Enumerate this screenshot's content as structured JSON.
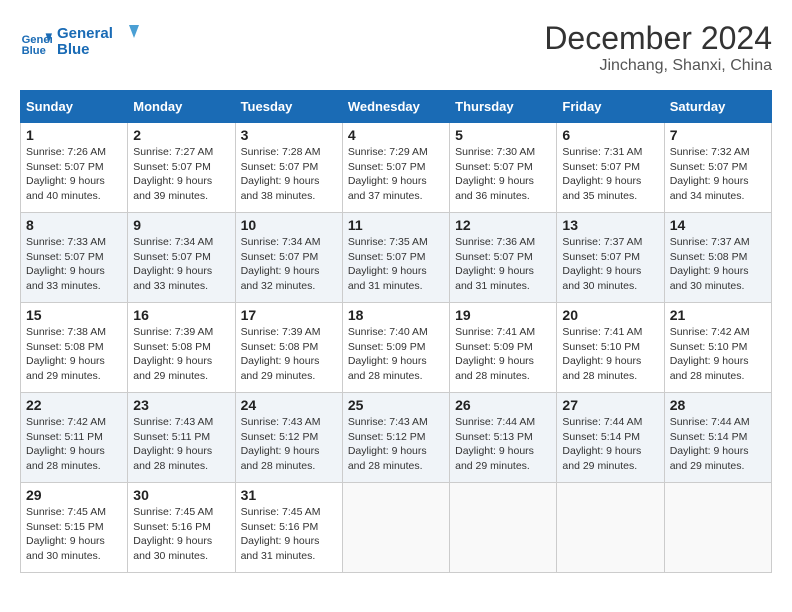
{
  "header": {
    "logo_line1": "General",
    "logo_line2": "Blue",
    "month": "December 2024",
    "location": "Jinchang, Shanxi, China"
  },
  "weekdays": [
    "Sunday",
    "Monday",
    "Tuesday",
    "Wednesday",
    "Thursday",
    "Friday",
    "Saturday"
  ],
  "weeks": [
    [
      {
        "day": "1",
        "sunrise": "Sunrise: 7:26 AM",
        "sunset": "Sunset: 5:07 PM",
        "daylight": "Daylight: 9 hours and 40 minutes."
      },
      {
        "day": "2",
        "sunrise": "Sunrise: 7:27 AM",
        "sunset": "Sunset: 5:07 PM",
        "daylight": "Daylight: 9 hours and 39 minutes."
      },
      {
        "day": "3",
        "sunrise": "Sunrise: 7:28 AM",
        "sunset": "Sunset: 5:07 PM",
        "daylight": "Daylight: 9 hours and 38 minutes."
      },
      {
        "day": "4",
        "sunrise": "Sunrise: 7:29 AM",
        "sunset": "Sunset: 5:07 PM",
        "daylight": "Daylight: 9 hours and 37 minutes."
      },
      {
        "day": "5",
        "sunrise": "Sunrise: 7:30 AM",
        "sunset": "Sunset: 5:07 PM",
        "daylight": "Daylight: 9 hours and 36 minutes."
      },
      {
        "day": "6",
        "sunrise": "Sunrise: 7:31 AM",
        "sunset": "Sunset: 5:07 PM",
        "daylight": "Daylight: 9 hours and 35 minutes."
      },
      {
        "day": "7",
        "sunrise": "Sunrise: 7:32 AM",
        "sunset": "Sunset: 5:07 PM",
        "daylight": "Daylight: 9 hours and 34 minutes."
      }
    ],
    [
      {
        "day": "8",
        "sunrise": "Sunrise: 7:33 AM",
        "sunset": "Sunset: 5:07 PM",
        "daylight": "Daylight: 9 hours and 33 minutes."
      },
      {
        "day": "9",
        "sunrise": "Sunrise: 7:34 AM",
        "sunset": "Sunset: 5:07 PM",
        "daylight": "Daylight: 9 hours and 33 minutes."
      },
      {
        "day": "10",
        "sunrise": "Sunrise: 7:34 AM",
        "sunset": "Sunset: 5:07 PM",
        "daylight": "Daylight: 9 hours and 32 minutes."
      },
      {
        "day": "11",
        "sunrise": "Sunrise: 7:35 AM",
        "sunset": "Sunset: 5:07 PM",
        "daylight": "Daylight: 9 hours and 31 minutes."
      },
      {
        "day": "12",
        "sunrise": "Sunrise: 7:36 AM",
        "sunset": "Sunset: 5:07 PM",
        "daylight": "Daylight: 9 hours and 31 minutes."
      },
      {
        "day": "13",
        "sunrise": "Sunrise: 7:37 AM",
        "sunset": "Sunset: 5:07 PM",
        "daylight": "Daylight: 9 hours and 30 minutes."
      },
      {
        "day": "14",
        "sunrise": "Sunrise: 7:37 AM",
        "sunset": "Sunset: 5:08 PM",
        "daylight": "Daylight: 9 hours and 30 minutes."
      }
    ],
    [
      {
        "day": "15",
        "sunrise": "Sunrise: 7:38 AM",
        "sunset": "Sunset: 5:08 PM",
        "daylight": "Daylight: 9 hours and 29 minutes."
      },
      {
        "day": "16",
        "sunrise": "Sunrise: 7:39 AM",
        "sunset": "Sunset: 5:08 PM",
        "daylight": "Daylight: 9 hours and 29 minutes."
      },
      {
        "day": "17",
        "sunrise": "Sunrise: 7:39 AM",
        "sunset": "Sunset: 5:08 PM",
        "daylight": "Daylight: 9 hours and 29 minutes."
      },
      {
        "day": "18",
        "sunrise": "Sunrise: 7:40 AM",
        "sunset": "Sunset: 5:09 PM",
        "daylight": "Daylight: 9 hours and 28 minutes."
      },
      {
        "day": "19",
        "sunrise": "Sunrise: 7:41 AM",
        "sunset": "Sunset: 5:09 PM",
        "daylight": "Daylight: 9 hours and 28 minutes."
      },
      {
        "day": "20",
        "sunrise": "Sunrise: 7:41 AM",
        "sunset": "Sunset: 5:10 PM",
        "daylight": "Daylight: 9 hours and 28 minutes."
      },
      {
        "day": "21",
        "sunrise": "Sunrise: 7:42 AM",
        "sunset": "Sunset: 5:10 PM",
        "daylight": "Daylight: 9 hours and 28 minutes."
      }
    ],
    [
      {
        "day": "22",
        "sunrise": "Sunrise: 7:42 AM",
        "sunset": "Sunset: 5:11 PM",
        "daylight": "Daylight: 9 hours and 28 minutes."
      },
      {
        "day": "23",
        "sunrise": "Sunrise: 7:43 AM",
        "sunset": "Sunset: 5:11 PM",
        "daylight": "Daylight: 9 hours and 28 minutes."
      },
      {
        "day": "24",
        "sunrise": "Sunrise: 7:43 AM",
        "sunset": "Sunset: 5:12 PM",
        "daylight": "Daylight: 9 hours and 28 minutes."
      },
      {
        "day": "25",
        "sunrise": "Sunrise: 7:43 AM",
        "sunset": "Sunset: 5:12 PM",
        "daylight": "Daylight: 9 hours and 28 minutes."
      },
      {
        "day": "26",
        "sunrise": "Sunrise: 7:44 AM",
        "sunset": "Sunset: 5:13 PM",
        "daylight": "Daylight: 9 hours and 29 minutes."
      },
      {
        "day": "27",
        "sunrise": "Sunrise: 7:44 AM",
        "sunset": "Sunset: 5:14 PM",
        "daylight": "Daylight: 9 hours and 29 minutes."
      },
      {
        "day": "28",
        "sunrise": "Sunrise: 7:44 AM",
        "sunset": "Sunset: 5:14 PM",
        "daylight": "Daylight: 9 hours and 29 minutes."
      }
    ],
    [
      {
        "day": "29",
        "sunrise": "Sunrise: 7:45 AM",
        "sunset": "Sunset: 5:15 PM",
        "daylight": "Daylight: 9 hours and 30 minutes."
      },
      {
        "day": "30",
        "sunrise": "Sunrise: 7:45 AM",
        "sunset": "Sunset: 5:16 PM",
        "daylight": "Daylight: 9 hours and 30 minutes."
      },
      {
        "day": "31",
        "sunrise": "Sunrise: 7:45 AM",
        "sunset": "Sunset: 5:16 PM",
        "daylight": "Daylight: 9 hours and 31 minutes."
      },
      null,
      null,
      null,
      null
    ]
  ]
}
